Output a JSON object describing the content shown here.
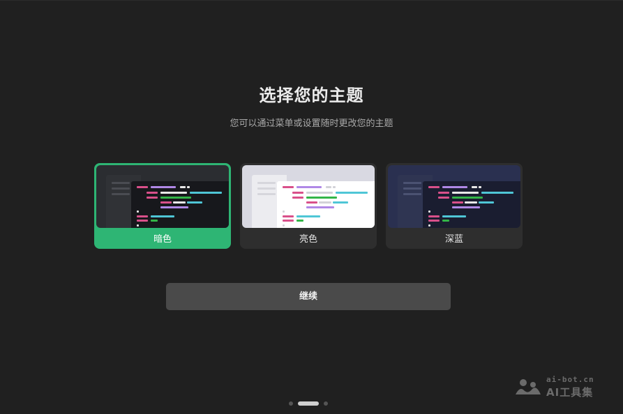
{
  "onboarding": {
    "title": "选择您的主题",
    "subtitle": "您可以通过菜单或设置随时更改您的主题"
  },
  "themes": [
    {
      "label": "暗色",
      "selected": true
    },
    {
      "label": "亮色",
      "selected": false
    },
    {
      "label": "深蓝",
      "selected": false
    }
  ],
  "continue_label": "继续",
  "pager": {
    "total": 3,
    "current": 2
  },
  "watermark": {
    "line1": "ai-bot.cn",
    "line2": "AI工具集"
  },
  "colors": {
    "accent": "#2eb574",
    "background": "#202020",
    "button": "#4a4a4a",
    "code_pink": "#d9508a",
    "code_purple": "#b088e6",
    "code_cyan": "#4fc6d6",
    "code_green": "#33b548",
    "code_white": "#e8e8e8"
  }
}
